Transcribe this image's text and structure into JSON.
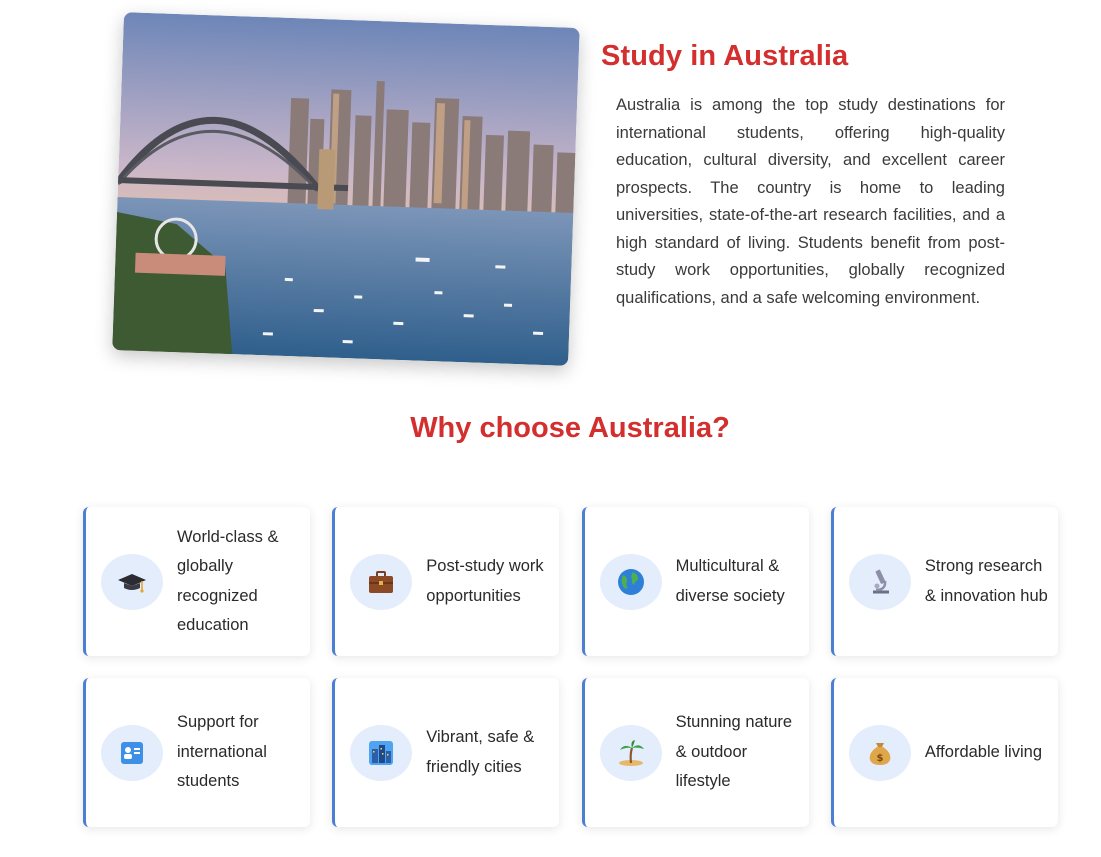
{
  "intro": {
    "title": "Study in Australia",
    "paragraph": "Australia is among the top study destinations for international students, offering high-quality education, cultural diversity, and excellent career prospects. The country is home to leading universities, state-of-the-art research facilities, and a high standard of living. Students benefit from post-study work opportunities, globally recognized qualifications, and a safe welcoming environment."
  },
  "why": {
    "title": "Why choose Australia?",
    "cards": [
      {
        "label": "World-class & globally recognized education",
        "icon": "graduation-cap-icon"
      },
      {
        "label": "Post-study work opportunities",
        "icon": "briefcase-icon"
      },
      {
        "label": "Multicultural & diverse society",
        "icon": "globe-icon"
      },
      {
        "label": "Strong research & innovation hub",
        "icon": "microscope-icon"
      },
      {
        "label": "Support for international students",
        "icon": "id-card-icon"
      },
      {
        "label": "Vibrant, safe & friendly cities",
        "icon": "cityscape-icon"
      },
      {
        "label": "Stunning nature & outdoor lifestyle",
        "icon": "palm-tree-island-icon"
      },
      {
        "label": "Affordable living",
        "icon": "money-bag-icon"
      }
    ]
  },
  "colors": {
    "accent": "#d32f2f",
    "card_border": "#4a7fd4",
    "icon_bg": "#e3edfb"
  }
}
